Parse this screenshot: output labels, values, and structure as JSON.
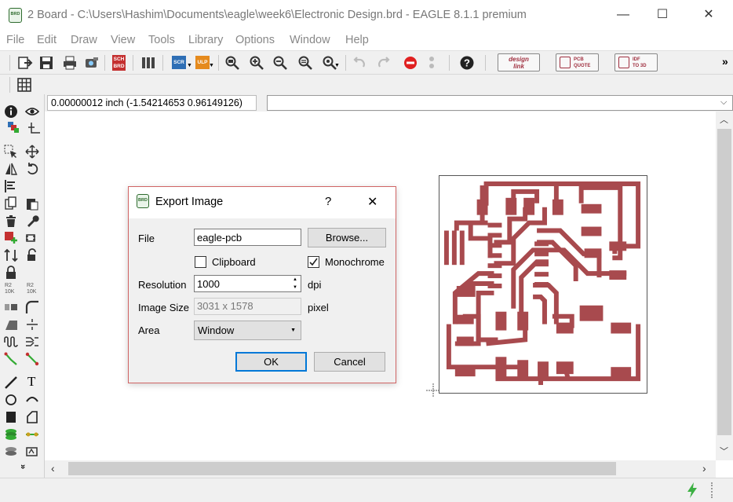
{
  "window": {
    "title": "2 Board - C:\\Users\\Hashim\\Documents\\eagle\\week6\\Electronic Design.brd - EAGLE 8.1.1 premium",
    "icon": "brd-app-icon",
    "app_icon_text": "BRD",
    "minimize": "—",
    "maximize": "☐",
    "close": "✕"
  },
  "menu": [
    "File",
    "Edit",
    "Draw",
    "View",
    "Tools",
    "Library",
    "Options",
    "Window",
    "Help"
  ],
  "toolbar": {
    "sch_brd_top": "SCH",
    "sch_brd_bottom": "BRD",
    "scr_label": "SCR",
    "ulp_label": "ULP",
    "design_link_line1": "design",
    "design_link_line2": "link",
    "pcb_quote_line1": "PCB",
    "pcb_quote_line2": "QUOTE",
    "idf_line1": "IDF",
    "idf_line2": "TO 3D",
    "overflow": "»"
  },
  "coordinates": {
    "readout": "0.00000012 inch (-1.54214653 0.96149126)",
    "command_value": ""
  },
  "left_toolbar": {
    "text_tool": "T",
    "more": "»",
    "r2_a_top": "R2",
    "r2_a_bottom": "10K",
    "r2_b_top": "R2",
    "r2_b_bottom": "10K"
  },
  "dialog": {
    "title": "Export Image",
    "help": "?",
    "close": "✕",
    "file_label": "File",
    "file_value": "eagle-pcb",
    "browse_label": "Browse...",
    "clipboard_label": "Clipboard",
    "clipboard_checked": false,
    "monochrome_label": "Monochrome",
    "monochrome_checked": true,
    "resolution_label": "Resolution",
    "resolution_value": "1000",
    "resolution_unit": "dpi",
    "image_size_label": "Image Size",
    "image_size_value": "3031 x 1578",
    "image_size_unit": "pixel",
    "area_label": "Area",
    "area_value": "Window",
    "ok_label": "OK",
    "cancel_label": "Cancel"
  },
  "colors": {
    "trace": "#a84a4e",
    "dialog_border": "#d06464",
    "focus_blue": "#0078d7",
    "status_green": "#3cb043"
  }
}
